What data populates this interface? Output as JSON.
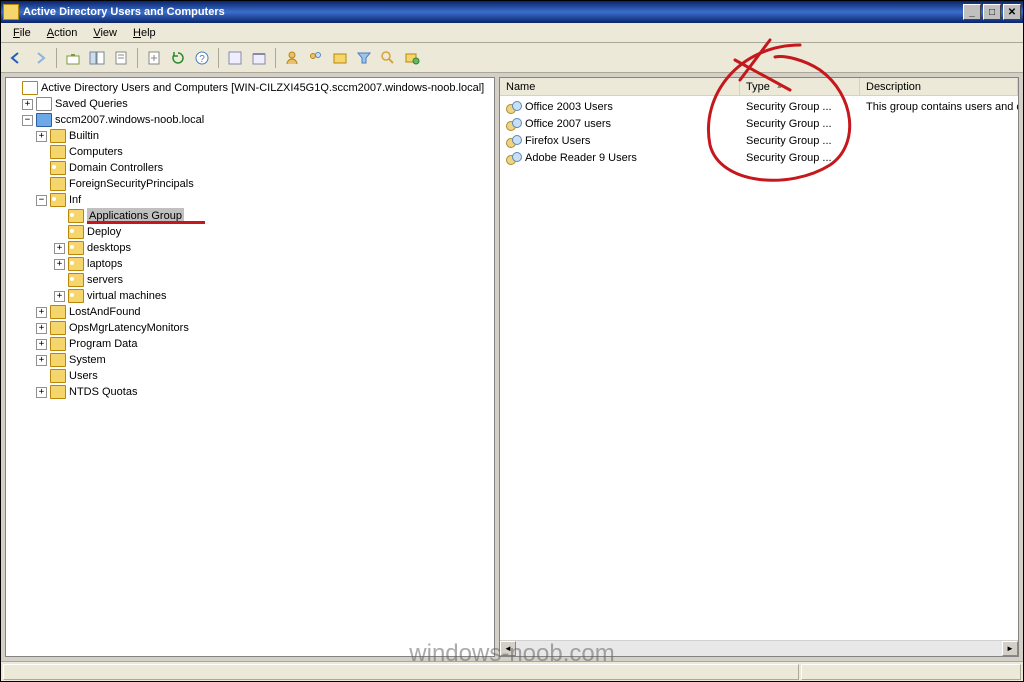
{
  "window": {
    "title": "Active Directory Users and Computers"
  },
  "menu": {
    "file": "File",
    "action": "Action",
    "view": "View",
    "help": "Help"
  },
  "toolbar_icons": [
    "back-icon",
    "forward-icon",
    "up-icon",
    "show-hide-tree-icon",
    "properties-icon",
    "export-icon",
    "refresh-icon",
    "help-icon",
    "cut-icon",
    "delete-icon",
    "new-user-icon",
    "new-group-icon",
    "new-ou-icon",
    "find-icon",
    "filter-icon",
    "add-icon"
  ],
  "tree": {
    "root": "Active Directory Users and Computers [WIN-CILZXI45G1Q.sccm2007.windows-noob.local]",
    "saved_queries": "Saved Queries",
    "domain": "sccm2007.windows-noob.local",
    "builtin": "Builtin",
    "computers": "Computers",
    "domain_controllers": "Domain Controllers",
    "fsp": "ForeignSecurityPrincipals",
    "inf": "Inf",
    "applications_group": "Applications Group",
    "deploy": "Deploy",
    "desktops": "desktops",
    "laptops": "laptops",
    "servers": "servers",
    "virtual_machines": "virtual machines",
    "lost_and_found": "LostAndFound",
    "ops_mgr": "OpsMgrLatencyMonitors",
    "program_data": "Program Data",
    "system": "System",
    "users": "Users",
    "ntds_quotas": "NTDS Quotas"
  },
  "list": {
    "columns": {
      "name": "Name",
      "type": "Type",
      "description": "Description"
    },
    "rows": [
      {
        "name": "Office 2003 Users",
        "type": "Security Group ...",
        "description": "This group contains users and computers t"
      },
      {
        "name": "Office 2007 users",
        "type": "Security Group ...",
        "description": ""
      },
      {
        "name": "Firefox Users",
        "type": "Security Group ...",
        "description": ""
      },
      {
        "name": "Adobe Reader 9 Users",
        "type": "Security Group ...",
        "description": ""
      }
    ]
  },
  "col_widths": {
    "name": 240,
    "type": 120,
    "description": 220
  },
  "watermark": "windows-noob.com"
}
